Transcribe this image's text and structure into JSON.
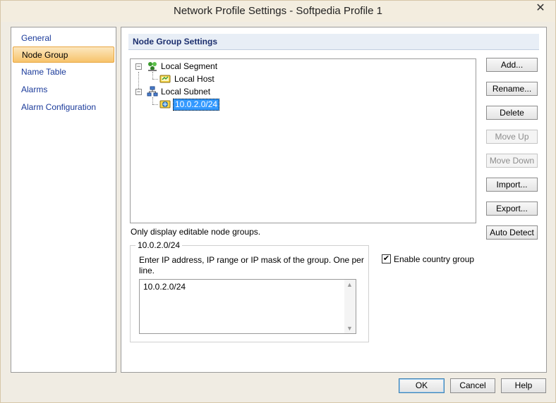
{
  "window": {
    "title": "Network Profile Settings - Softpedia Profile 1",
    "close_label": "✕"
  },
  "nav": {
    "items": [
      {
        "label": "General"
      },
      {
        "label": "Node Group"
      },
      {
        "label": "Name Table"
      },
      {
        "label": "Alarms"
      },
      {
        "label": "Alarm Configuration"
      }
    ],
    "active": "Node Group"
  },
  "panel": {
    "header": "Node Group Settings",
    "tree": {
      "nodes": [
        {
          "label": "Local Segment",
          "icon": "network-group-icon",
          "expanded": true
        },
        {
          "label": "Local Host",
          "icon": "host-icon"
        },
        {
          "label": "Local Subnet",
          "icon": "subnet-icon",
          "expanded": true
        },
        {
          "label": "10.0.2.0/24",
          "icon": "ip-group-icon",
          "selected": true
        }
      ]
    },
    "buttons": {
      "add": "Add...",
      "rename": "Rename...",
      "delete": "Delete",
      "move_up": "Move Up",
      "move_down": "Move Down",
      "import": "Import...",
      "export": "Export...",
      "auto_detect": "Auto Detect"
    },
    "only_display_text": "Only display editable node groups.",
    "group": {
      "title": "10.0.2.0/24",
      "description": "Enter IP address, IP range or IP mask of the group. One per line.",
      "ip_value": "10.0.2.0/24"
    },
    "enable_country_group": {
      "label": "Enable country group",
      "checked": true
    }
  },
  "footer": {
    "ok": "OK",
    "cancel": "Cancel",
    "help": "Help"
  },
  "colors": {
    "accent": "#f7c36b",
    "selection": "#3399ff",
    "header_text": "#1c2f6e"
  }
}
